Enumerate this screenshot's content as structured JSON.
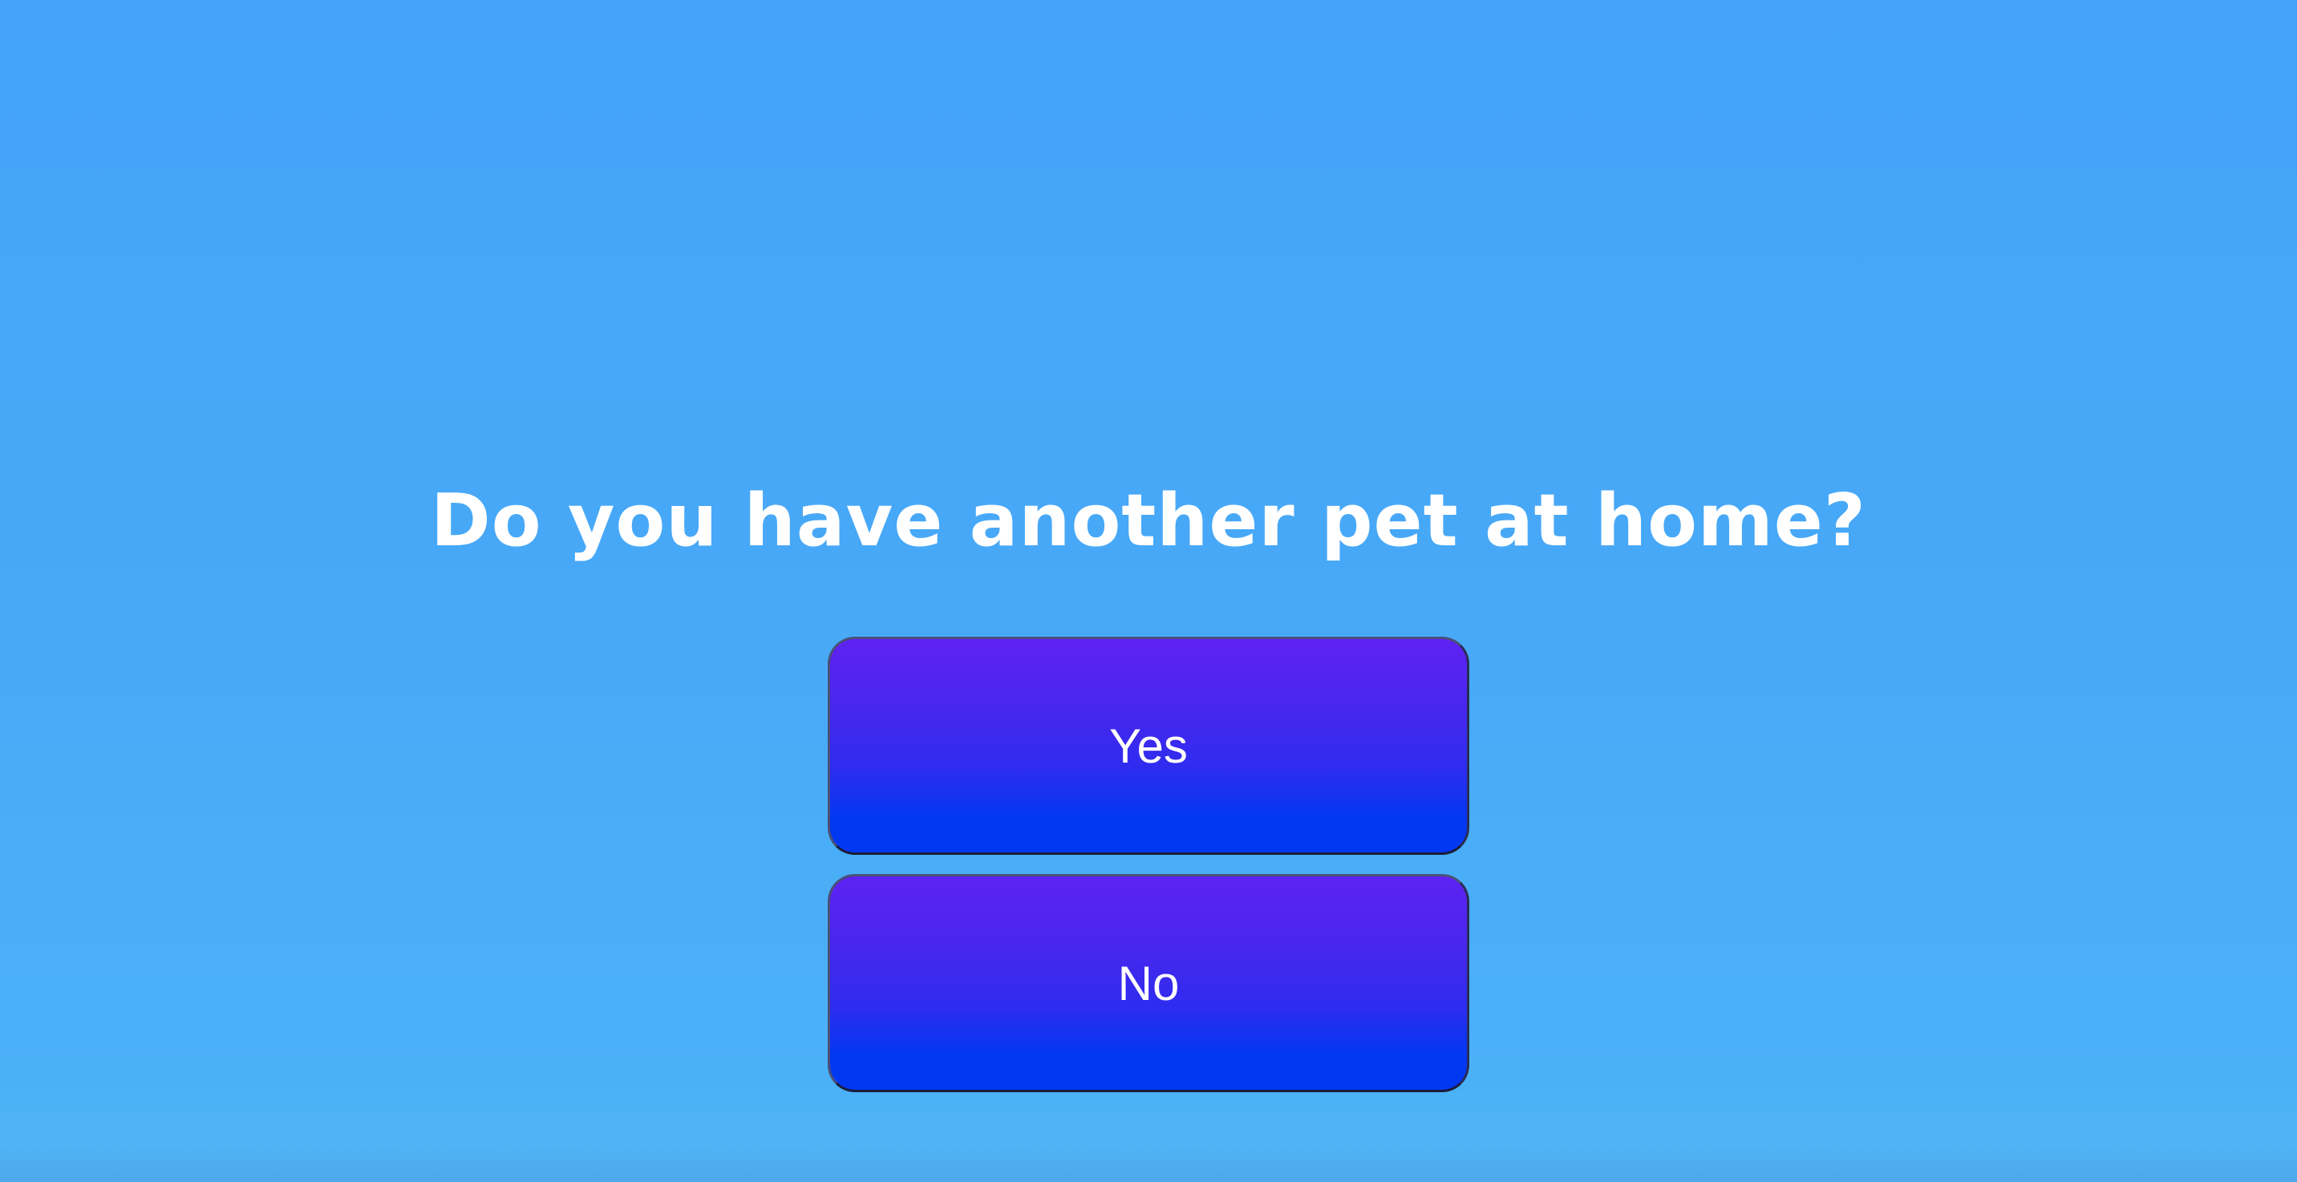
{
  "question": {
    "text": "Do you have another pet at home?"
  },
  "answers": [
    {
      "label": "Yes"
    },
    {
      "label": "No"
    }
  ],
  "colors": {
    "background": "#47a8f7",
    "button_top": "#5e22f3",
    "button_bottom": "#0038f2",
    "text": "#ffffff"
  }
}
